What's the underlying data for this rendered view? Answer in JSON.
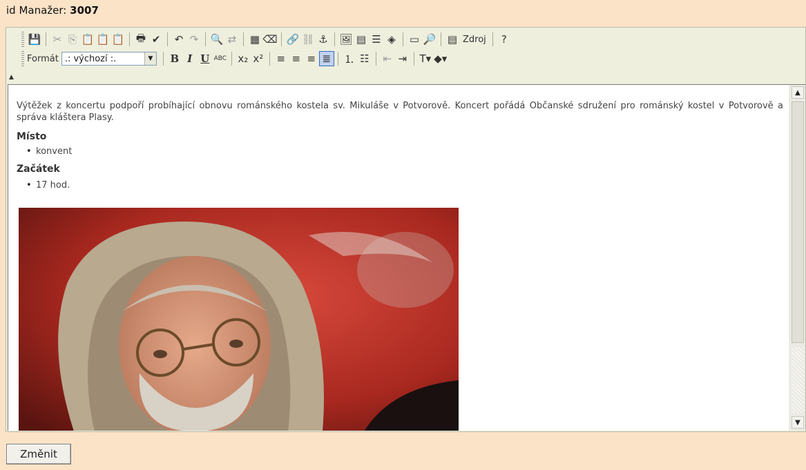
{
  "header": {
    "label": "id Manažer:",
    "value": "3007"
  },
  "toolbar": {
    "row1": [
      {
        "name": "save-icon",
        "glyph": "💾"
      },
      {
        "sep": true
      },
      {
        "name": "cut-icon",
        "glyph": "✂",
        "dim": true
      },
      {
        "name": "copy-icon",
        "glyph": "⎘",
        "dim": true
      },
      {
        "name": "paste-icon",
        "glyph": "📋",
        "dim": true
      },
      {
        "name": "paste-text-icon",
        "glyph": "📋",
        "dim": true
      },
      {
        "name": "paste-word-icon",
        "glyph": "📋",
        "dim": true
      },
      {
        "sep": true
      },
      {
        "name": "print-icon",
        "glyph": "🖶"
      },
      {
        "name": "spellcheck-icon",
        "glyph": "✔"
      },
      {
        "sep": true
      },
      {
        "name": "undo-icon",
        "glyph": "↶"
      },
      {
        "name": "redo-icon",
        "glyph": "↷",
        "dim": true
      },
      {
        "sep": true
      },
      {
        "name": "find-icon",
        "glyph": "🔍"
      },
      {
        "name": "replace-icon",
        "glyph": "⇄",
        "dim": true
      },
      {
        "sep": true
      },
      {
        "name": "select-all-icon",
        "glyph": "▦"
      },
      {
        "name": "remove-format-icon",
        "glyph": "⌫"
      },
      {
        "sep": true
      },
      {
        "name": "link-icon",
        "glyph": "🔗"
      },
      {
        "name": "unlink-icon",
        "glyph": "⛓",
        "dim": true
      },
      {
        "name": "anchor-icon",
        "glyph": "⚓"
      },
      {
        "sep": true
      },
      {
        "name": "image-icon",
        "glyph": "🖼"
      },
      {
        "name": "table-icon",
        "glyph": "▤"
      },
      {
        "name": "horizontal-rule-icon",
        "glyph": "☰"
      },
      {
        "name": "special-char-icon",
        "glyph": "◈"
      },
      {
        "sep": true
      },
      {
        "name": "flash-icon",
        "glyph": "▭"
      },
      {
        "name": "preview-icon",
        "glyph": "🔎"
      },
      {
        "sep": true
      },
      {
        "name": "source-icon",
        "glyph": "▤"
      },
      {
        "name": "source-label",
        "text": "Zdroj"
      },
      {
        "sep": true
      },
      {
        "name": "help-icon",
        "glyph": "?"
      }
    ],
    "format_label": "Formát",
    "format_value": ".: výchozí :.",
    "row2": [
      {
        "name": "bold-icon",
        "glyph": "B",
        "cls": "bold-btn"
      },
      {
        "name": "italic-icon",
        "glyph": "I",
        "cls": "ital-btn"
      },
      {
        "name": "underline-icon",
        "glyph": "U",
        "cls": "und-btn"
      },
      {
        "name": "strikethrough-icon",
        "glyph": "ABC",
        "small": true
      },
      {
        "sep": true
      },
      {
        "name": "subscript-icon",
        "glyph": "x₂"
      },
      {
        "name": "superscript-icon",
        "glyph": "x²"
      },
      {
        "sep": true
      },
      {
        "name": "align-left-icon",
        "glyph": "≡"
      },
      {
        "name": "align-center-icon",
        "glyph": "≡"
      },
      {
        "name": "align-right-icon",
        "glyph": "≡"
      },
      {
        "name": "align-justify-icon",
        "glyph": "≣",
        "active": true
      },
      {
        "sep": true
      },
      {
        "name": "numbered-list-icon",
        "glyph": "⒈"
      },
      {
        "name": "bulleted-list-icon",
        "glyph": "☷"
      },
      {
        "sep": true
      },
      {
        "name": "outdent-icon",
        "glyph": "⇤",
        "dim": true
      },
      {
        "name": "indent-icon",
        "glyph": "⇥"
      },
      {
        "sep": true
      },
      {
        "name": "text-color-icon",
        "glyph": "T▾"
      },
      {
        "name": "bg-color-icon",
        "glyph": "◆▾"
      }
    ]
  },
  "content": {
    "paragraph": "Výtěžek z koncertu podpoří probíhající obnovu románského kostela sv. Mikuláše v Potvorově. Koncert pořádá Občanské sdružení pro románský kostel v Potvorově a správa kláštera Plasy.",
    "heading1": "Místo",
    "item1": "konvent",
    "heading2": "Začátek",
    "item2": "17 hod."
  },
  "submit_label": "Změnit"
}
